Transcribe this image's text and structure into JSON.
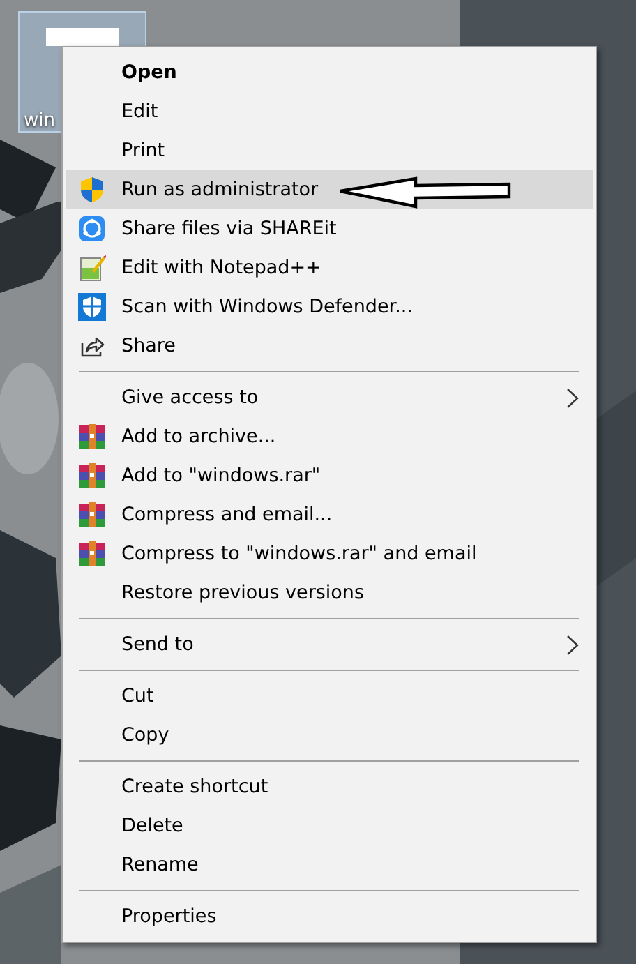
{
  "desktop_icon": {
    "label": "win",
    "selected": true
  },
  "context_menu": {
    "sections": [
      {
        "items": [
          {
            "label": "Open",
            "kind": "plain",
            "bold": true,
            "selected": false,
            "submenu": false
          },
          {
            "label": "Edit",
            "kind": "plain",
            "bold": false,
            "selected": false,
            "submenu": false
          },
          {
            "label": "Print",
            "kind": "plain",
            "bold": false,
            "selected": false,
            "submenu": false
          },
          {
            "label": "Run as administrator",
            "kind": "admin",
            "bold": false,
            "selected": true,
            "submenu": false
          },
          {
            "label": "Share files via SHAREit",
            "kind": "shareit",
            "bold": false,
            "selected": false,
            "submenu": false
          },
          {
            "label": "Edit with Notepad++",
            "kind": "notepad",
            "bold": false,
            "selected": false,
            "submenu": false
          },
          {
            "label": "Scan with Windows Defender...",
            "kind": "defender",
            "bold": false,
            "selected": false,
            "submenu": false
          },
          {
            "label": "Share",
            "kind": "share",
            "bold": false,
            "selected": false,
            "submenu": false
          }
        ]
      },
      {
        "items": [
          {
            "label": "Give access to",
            "kind": "plain",
            "bold": false,
            "selected": false,
            "submenu": true
          },
          {
            "label": "Add to archive...",
            "kind": "winrar",
            "bold": false,
            "selected": false,
            "submenu": false
          },
          {
            "label": "Add to \"windows.rar\"",
            "kind": "winrar",
            "bold": false,
            "selected": false,
            "submenu": false
          },
          {
            "label": "Compress and email...",
            "kind": "winrar",
            "bold": false,
            "selected": false,
            "submenu": false
          },
          {
            "label": "Compress to \"windows.rar\" and email",
            "kind": "winrar",
            "bold": false,
            "selected": false,
            "submenu": false
          },
          {
            "label": "Restore previous versions",
            "kind": "plain",
            "bold": false,
            "selected": false,
            "submenu": false
          }
        ]
      },
      {
        "items": [
          {
            "label": "Send to",
            "kind": "plain",
            "bold": false,
            "selected": false,
            "submenu": true
          }
        ]
      },
      {
        "items": [
          {
            "label": "Cut",
            "kind": "plain",
            "bold": false,
            "selected": false,
            "submenu": false
          },
          {
            "label": "Copy",
            "kind": "plain",
            "bold": false,
            "selected": false,
            "submenu": false
          }
        ]
      },
      {
        "items": [
          {
            "label": "Create shortcut",
            "kind": "plain",
            "bold": false,
            "selected": false,
            "submenu": false
          },
          {
            "label": "Delete",
            "kind": "plain",
            "bold": false,
            "selected": false,
            "submenu": false
          },
          {
            "label": "Rename",
            "kind": "plain",
            "bold": false,
            "selected": false,
            "submenu": false
          }
        ]
      },
      {
        "items": [
          {
            "label": "Properties",
            "kind": "plain",
            "bold": false,
            "selected": false,
            "submenu": false
          }
        ]
      }
    ]
  }
}
